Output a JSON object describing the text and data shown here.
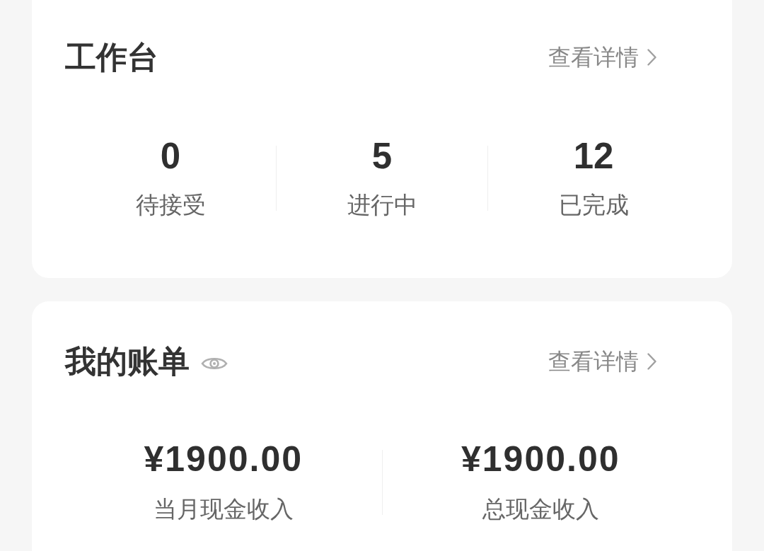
{
  "cards": [
    {
      "kind": "tasks",
      "title": "工作台",
      "link": {
        "label": "查看详情"
      },
      "stats": [
        {
          "value": "0",
          "label": "待接受"
        },
        {
          "value": "5",
          "label": "进行中"
        },
        {
          "value": "12",
          "label": "已完成"
        }
      ]
    },
    {
      "kind": "bill",
      "title": "我的账单",
      "link": {
        "label": "查看详情"
      },
      "stats": [
        {
          "value": "¥1900.00",
          "label": "当月现金收入"
        },
        {
          "value": "¥1900.00",
          "label": "总现金收入"
        }
      ]
    }
  ]
}
